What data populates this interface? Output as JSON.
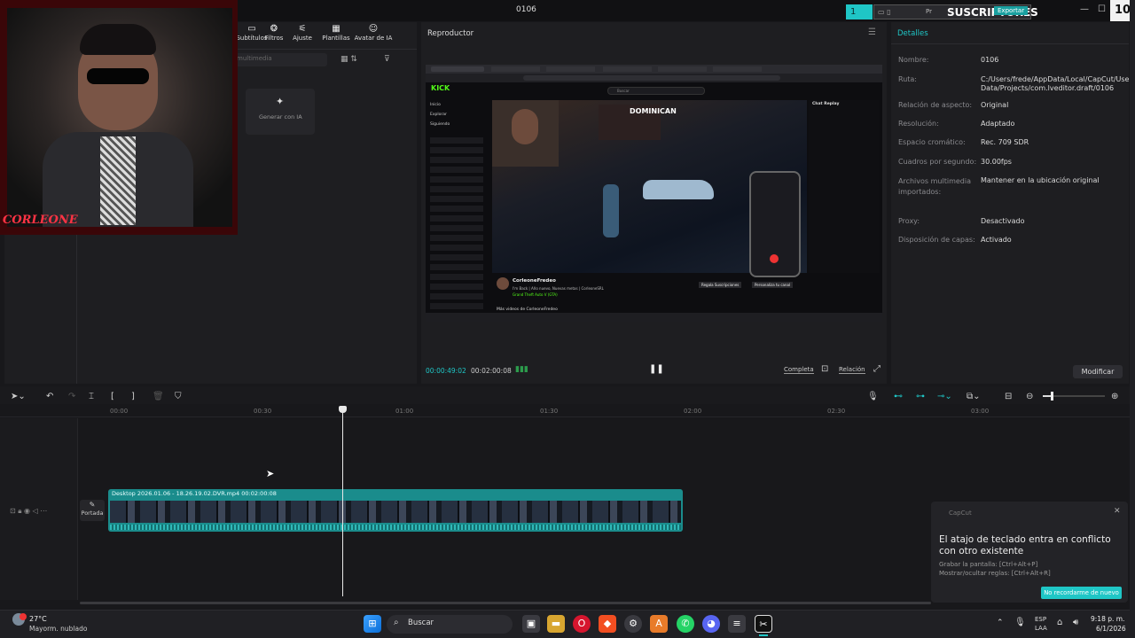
{
  "window": {
    "title": "0106"
  },
  "overlay": {
    "banner": "SUSCRIPTORES",
    "counter": "10",
    "banner_num": "1",
    "export_label": "Exportar",
    "pr_label": "Pr"
  },
  "toolbar": {
    "items": [
      "Subtítulos",
      "Filtros",
      "Ajuste",
      "Plantillas",
      "Avatar de IA"
    ]
  },
  "media": {
    "search_placeholder": "multimedia",
    "generate_label": "Generar con IA"
  },
  "player": {
    "title": "Reproductor",
    "time_current": "00:00:49:02",
    "time_total": "00:02:00:08",
    "btn_full": "Completa",
    "btn_ratio": "Relación"
  },
  "details": {
    "title": "Detalles",
    "rows": [
      {
        "label": "Nombre:",
        "value": "0106"
      },
      {
        "label": "Ruta:",
        "value": "C:/Users/frede/AppData/Local/CapCut/User Data/Projects/com.lveditor.draft/0106"
      },
      {
        "label": "Relación de aspecto:",
        "value": "Original"
      },
      {
        "label": "Resolución:",
        "value": "Adaptado"
      },
      {
        "label": "Espacio cromático:",
        "value": "Rec. 709 SDR"
      },
      {
        "label": "Cuadros por segundo:",
        "value": "30.00fps"
      },
      {
        "label": "Archivos multimedia importados:",
        "value": "Mantener en la ubicación original"
      },
      {
        "label": "Proxy:",
        "value": "Desactivado"
      },
      {
        "label": "Disposición de capas:",
        "value": "Activado"
      }
    ],
    "modify_button": "Modificar"
  },
  "stream": {
    "kick": "KICK",
    "streamer": "CorleoneFredeo",
    "stream_title": "I'm Back | Año nuevo, Nuevas metas | CorleoneSRL",
    "game": "Grand Theft Auto V (GTA)",
    "overlay_text": "DOMINICAN",
    "chat_title": "Chat Replay",
    "more_videos": "Más videos de CorleoneFredeo",
    "sidebar": [
      "Inicio",
      "Explorar",
      "Siguiendo"
    ],
    "btn_sub": "Regala Suscripciones",
    "btn_custom": "Personaliza tu canal",
    "search": "Buscar",
    "webcam_tag": "CORLEONE"
  },
  "timeline": {
    "ruler": [
      "00:00",
      "00:30",
      "01:00",
      "01:30",
      "02:00",
      "02:30",
      "03:00"
    ],
    "clip_label": "Desktop 2026.01.06 - 18.26.19.02.DVR.mp4   00:02:00:08",
    "cover_label": "Portada"
  },
  "notification": {
    "app": "CapCut",
    "message": "El atajo de teclado entra en conflicto con otro existente",
    "line1": "Grabar la pantalla: [Ctrl+Alt+P]",
    "line2": "Mostrar/ocultar reglas: [Ctrl+Alt+R]",
    "button": "No recordarme de nuevo"
  },
  "taskbar": {
    "weather_temp": "27°C",
    "weather_desc": "Mayorm. nublado",
    "search_label": "Buscar",
    "lang1": "ESP",
    "lang2": "LAA",
    "time": "9:18 p. m.",
    "date": "6/1/2026"
  },
  "colors": {
    "accent": "#1fc6c6",
    "clip": "#1a8c8c",
    "kick": "#53fc18"
  }
}
